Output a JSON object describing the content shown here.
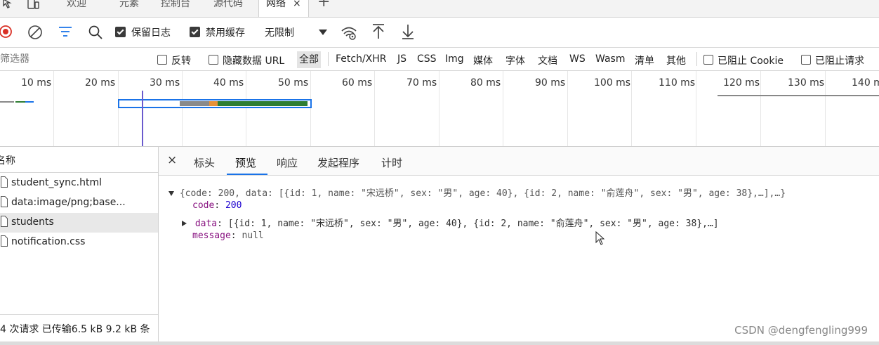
{
  "tabs": [
    {
      "label": "欢迎"
    },
    {
      "label": "元素"
    },
    {
      "label": "控制台"
    },
    {
      "label": "源代码"
    },
    {
      "label": "网络",
      "active": true
    }
  ],
  "add_tab_label": "+",
  "toolbar": {
    "preserve_log": "保留日志",
    "disable_cache": "禁用缓存",
    "throttling": "无限制",
    "preserve_log_checked": true,
    "disable_cache_checked": true
  },
  "filter": {
    "placeholder": "筛选器",
    "invert": "反转",
    "hide_data_urls": "隐藏数据 URL",
    "types": [
      "全部",
      "Fetch/XHR",
      "JS",
      "CSS",
      "Img",
      "媒体",
      "字体",
      "文档",
      "WS",
      "Wasm",
      "清单",
      "其他"
    ],
    "active_type": "全部",
    "blocked_cookies": "已阻止 Cookie",
    "blocked_requests": "已阻止请求"
  },
  "timeline": {
    "ticks": [
      "10 ms",
      "20 ms",
      "30 ms",
      "40 ms",
      "50 ms",
      "60 ms",
      "70 ms",
      "80 ms",
      "90 ms",
      "100 ms",
      "110 ms",
      "120 ms",
      "130 ms",
      "140 m"
    ]
  },
  "requests": {
    "column_name": "名称",
    "items": [
      {
        "name": "student_sync.html"
      },
      {
        "name": "data:image/png;base..."
      },
      {
        "name": "students",
        "selected": true
      },
      {
        "name": "notification.css"
      }
    ],
    "status": "4 次请求  已传输6.5 kB  9.2 kB 条"
  },
  "detail": {
    "close": "×",
    "tabs": [
      "标头",
      "预览",
      "响应",
      "发起程序",
      "计时"
    ],
    "active_tab": "预览",
    "preview": {
      "summary": "{code: 200, data: [{id: 1, name: \"宋远桥\", sex: \"男\", age: 40}, {id: 2, name: \"俞莲舟\", sex: \"男\", age: 38},…],…}",
      "code_key": "code",
      "code_value": "200",
      "data_key": "data",
      "data_value": "[{id: 1, name: \"宋远桥\", sex: \"男\", age: 40}, {id: 2, name: \"俞莲舟\", sex: \"男\", age: 38},…]",
      "message_key": "message",
      "message_value": "null"
    }
  },
  "watermark": "CSDN @dengfengling999",
  "colors": {
    "record": "#d93025",
    "accent": "#1a73e8",
    "waterfall_waiting": "#2e7d32",
    "waterfall_blocked": "#8a8a8a",
    "waterfall_orange": "#e69138"
  },
  "icons": [
    "inspect-icon",
    "device-toolbar-icon",
    "record-icon",
    "clear-icon",
    "filter-icon",
    "search-icon",
    "dropdown-icon",
    "network-conditions-icon",
    "upload-icon",
    "download-icon",
    "file-icon",
    "close-icon"
  ]
}
